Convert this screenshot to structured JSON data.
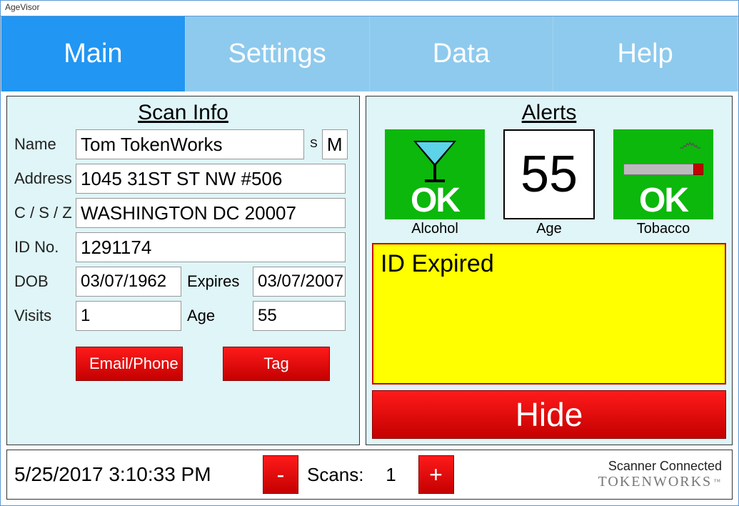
{
  "window": {
    "title": "AgeVisor"
  },
  "tabs": {
    "main": "Main",
    "settings": "Settings",
    "data": "Data",
    "help": "Help"
  },
  "scanInfo": {
    "title": "Scan Info",
    "labels": {
      "name": "Name",
      "sex": "S",
      "address": "Address",
      "csz": "C / S / Z",
      "id": "ID No.",
      "dob": "DOB",
      "expires": "Expires",
      "visits": "Visits",
      "age": "Age"
    },
    "values": {
      "name": "Tom  TokenWorks",
      "sex": "M",
      "address": "1045 31ST ST NW #506",
      "csz": "WASHINGTON DC 20007",
      "id": "1291174",
      "dob": "03/07/1962",
      "expires": "03/07/2007",
      "visits": "1",
      "age": "55"
    },
    "buttons": {
      "emailPhone": "Email/Phone",
      "tag": "Tag"
    }
  },
  "alerts": {
    "title": "Alerts",
    "alcohol": {
      "caption": "Alcohol",
      "status": "OK"
    },
    "age": {
      "caption": "Age",
      "value": "55"
    },
    "tobacco": {
      "caption": "Tobacco",
      "status": "OK"
    },
    "message": "ID Expired",
    "hide": "Hide"
  },
  "status": {
    "datetime": "5/25/2017 3:10:33 PM",
    "minus": "-",
    "plus": "+",
    "scansLabel": "Scans:",
    "scansValue": "1",
    "scanner": "Scanner Connected",
    "brand": "TOKENWORKS",
    "tm": "™"
  }
}
